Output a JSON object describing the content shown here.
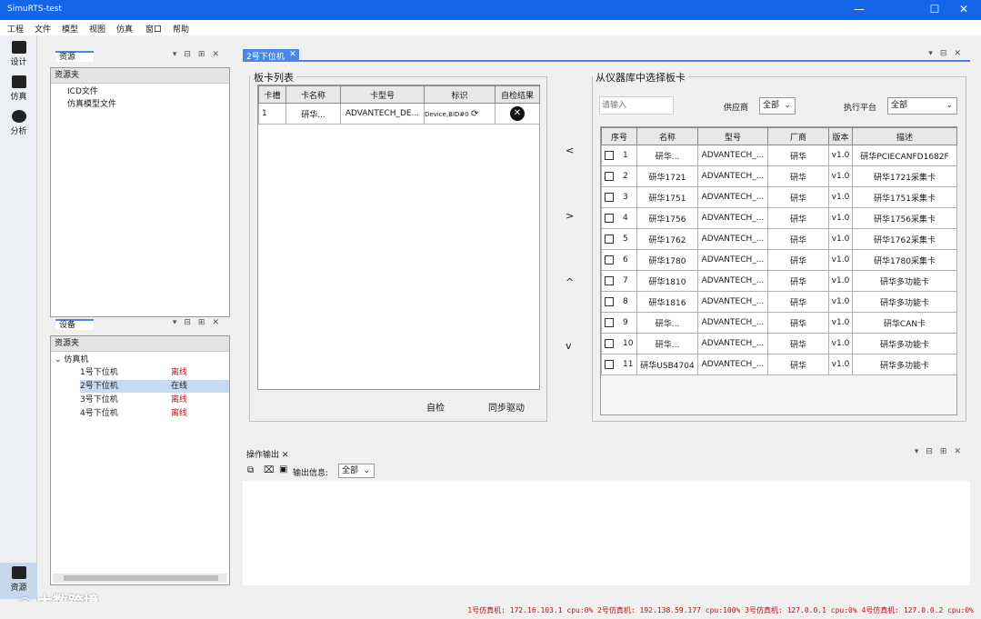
{
  "window": {
    "title": "SimuRTS-test"
  },
  "menu": [
    "工程",
    "文件",
    "模型",
    "视图",
    "仿真",
    "窗口",
    "帮助"
  ],
  "leftbar": [
    {
      "label": "设计",
      "icon": "design-icon"
    },
    {
      "label": "仿真",
      "icon": "monitor-icon"
    },
    {
      "label": "分析",
      "icon": "cube-icon"
    },
    {
      "label": "资源",
      "icon": "box-icon"
    }
  ],
  "resources_panel": {
    "tab": "资源",
    "header": "资源夹",
    "items": [
      "ICD文件",
      "仿真模型文件"
    ]
  },
  "device_panel": {
    "tab": "设备",
    "header": "资源夹",
    "root": "仿真机",
    "items": [
      {
        "name": "1号下位机",
        "status": "离线"
      },
      {
        "name": "2号下位机",
        "status": "在线"
      },
      {
        "name": "3号下位机",
        "status": "离线"
      },
      {
        "name": "4号下位机",
        "status": "离线"
      }
    ]
  },
  "doc_tab": {
    "label": "2号下位机"
  },
  "card_list": {
    "title": "板卡列表",
    "columns": [
      "卡槽",
      "卡名称",
      "卡型号",
      "标识",
      "自检结果"
    ],
    "rows": [
      {
        "slot": "1",
        "name": "研华...",
        "model": "ADVANTECH_DE...",
        "id": "Device,BID#0",
        "result": "fail"
      }
    ],
    "self_check": "自检",
    "sync": "同步驱动"
  },
  "arrows": [
    "<",
    ">",
    "^",
    "v"
  ],
  "instrument_lib": {
    "title": "从仪器库中选择板卡",
    "search_placeholder": "请输入",
    "vendor_label": "供应商",
    "vendor_value": "全部",
    "platform_label": "执行平台",
    "platform_value": "全部",
    "columns": [
      "序号",
      "名称",
      "型号",
      "厂商",
      "版本",
      "描述"
    ],
    "rows": [
      [
        "1",
        "研华...",
        "ADVANTECH_...",
        "研华",
        "v1.0",
        "研华PCIECANFD1682F"
      ],
      [
        "2",
        "研华1721",
        "ADVANTECH_...",
        "研华",
        "v1.0",
        "研华1721采集卡"
      ],
      [
        "3",
        "研华1751",
        "ADVANTECH_...",
        "研华",
        "v1.0",
        "研华1751采集卡"
      ],
      [
        "4",
        "研华1756",
        "ADVANTECH_...",
        "研华",
        "v1.0",
        "研华1756采集卡"
      ],
      [
        "5",
        "研华1762",
        "ADVANTECH_...",
        "研华",
        "v1.0",
        "研华1762采集卡"
      ],
      [
        "6",
        "研华1780",
        "ADVANTECH_...",
        "研华",
        "v1.0",
        "研华1780采集卡"
      ],
      [
        "7",
        "研华1810",
        "ADVANTECH_...",
        "研华",
        "v1.0",
        "研华多功能卡"
      ],
      [
        "8",
        "研华1816",
        "ADVANTECH_...",
        "研华",
        "v1.0",
        "研华多功能卡"
      ],
      [
        "9",
        "研华...",
        "ADVANTECH_...",
        "研华",
        "v1.0",
        "研华CAN卡"
      ],
      [
        "10",
        "研华...",
        "ADVANTECH_...",
        "研华",
        "v1.0",
        "研华多功能卡"
      ],
      [
        "11",
        "研华USB4704",
        "ADVANTECH_...",
        "研华",
        "v1.0",
        "研华多功能卡"
      ]
    ]
  },
  "output_panel": {
    "tab": "操作输出",
    "filter_label": "输出信息:",
    "filter_value": "全部"
  },
  "watermark": "大数跨境",
  "status": "1号仿真机: 172.16.103.1 cpu:0% 2号仿真机: 192.138.59.177 cpu:100% 3号仿真机: 127.0.0.1 cpu:0% 4号仿真机: 127.0.0.2 cpu:0%"
}
